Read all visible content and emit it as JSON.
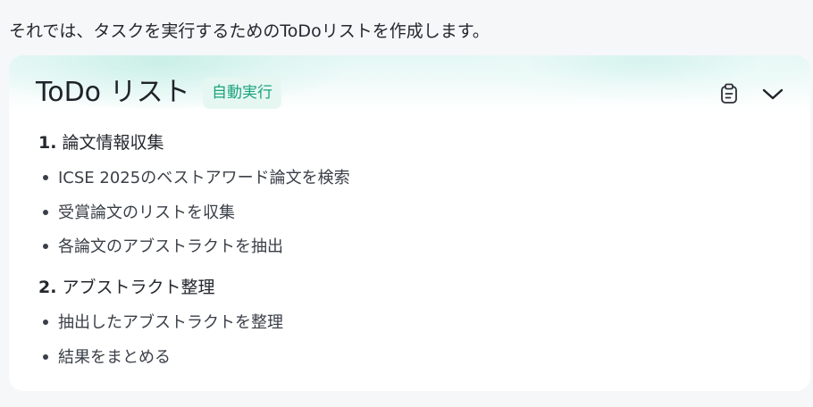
{
  "intro_text": "それでは、タスクを実行するためのToDoリストを作成します。",
  "card": {
    "title": "ToDo リスト",
    "badge": "自動実行",
    "icons": {
      "copy": "clipboard-icon",
      "collapse": "chevron-down-icon"
    },
    "accent_color": "#1aa37a"
  },
  "sections": [
    {
      "number": "1.",
      "title": "論文情報収集",
      "items": [
        "ICSE 2025のベストアワード論文を検索",
        "受賞論文のリストを収集",
        "各論文のアブストラクトを抽出"
      ]
    },
    {
      "number": "2.",
      "title": "アブストラクト整理",
      "items": [
        "抽出したアブストラクトを整理",
        "結果をまとめる"
      ]
    }
  ]
}
